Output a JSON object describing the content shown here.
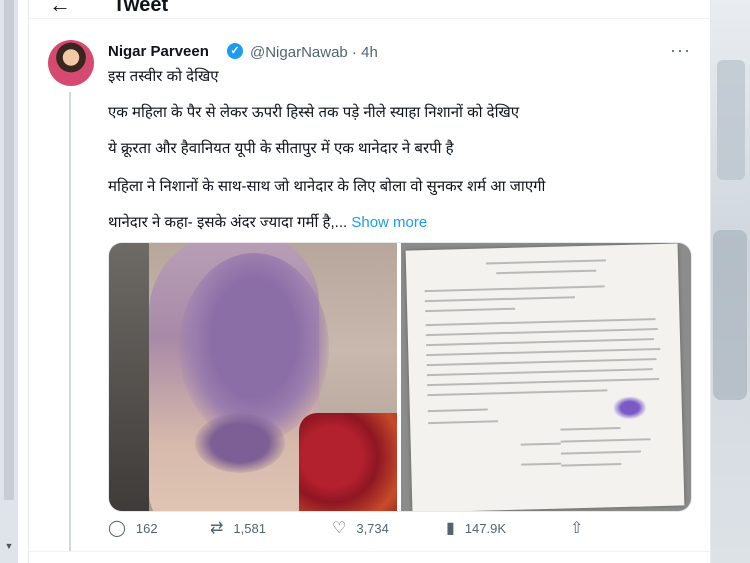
{
  "header": {
    "back_icon": "arrow-left-icon",
    "title": "Tweet"
  },
  "tweet": {
    "author_name": "Nigar Parveen",
    "verified_icon": "verified-badge-icon",
    "handle": "@NigarNawab",
    "time_sep": " · ",
    "time": "4h",
    "more_icon": "more-horizontal-icon",
    "lines": [
      "इस तस्वीर को देखिए",
      "एक महिला के पैर से लेकर ऊपरी हिस्से तक पड़े नीले स्याहा निशानों को देखिए",
      "ये क्रूरता और हैवानियत यूपी के सीतापुर में एक थानेदार ने बरपी है",
      "महिला ने निशानों के साथ-साथ जो थानेदार के लिए बोला वो सुनकर शर्म आ जाएगी",
      "थानेदार ने कहा- इसके अंदर ज्यादा गर्मी है,..."
    ],
    "show_more": "Show more",
    "media": [
      {
        "description": "bruised-leg-photo"
      },
      {
        "description": "handwritten-complaint-letter-photo"
      }
    ]
  },
  "actions": {
    "reply": {
      "icon": "reply-icon",
      "count": "162"
    },
    "retweet": {
      "icon": "retweet-icon",
      "count": "1,581"
    },
    "like": {
      "icon": "heart-icon",
      "count": "3,734"
    },
    "views": {
      "icon": "views-chart-icon",
      "count": "147.9K"
    },
    "share": {
      "icon": "share-icon"
    }
  },
  "colors": {
    "accent": "#1d9bf0",
    "text": "#0f1419",
    "secondary": "#536471"
  }
}
